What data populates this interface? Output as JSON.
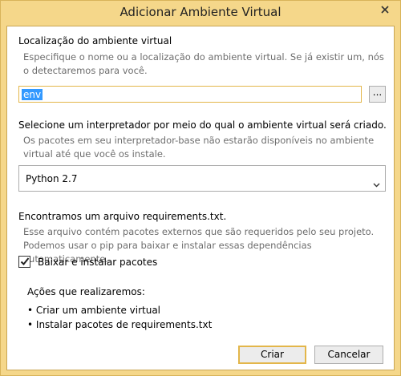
{
  "window": {
    "title": "Adicionar Ambiente Virtual"
  },
  "location": {
    "heading": "Localização do ambiente virtual",
    "description": "Especifique o nome ou a localização do ambiente virtual. Se já existir um, nós o detectaremos para você.",
    "value": "env",
    "browse_label": "..."
  },
  "interpreter": {
    "heading": "Selecione um interpretador por meio do qual o ambiente virtual será criado.",
    "description": "Os pacotes em seu interpretador-base não estarão disponíveis no ambiente virtual até que você os instale.",
    "selected": "Python 2.7"
  },
  "requirements": {
    "heading": "Encontramos um arquivo requirements.txt.",
    "description": "Esse arquivo contém pacotes externos que são requeridos pelo seu projeto. Podemos usar o pip para baixar e instalar essas dependências automaticamente.",
    "checkbox_label": "Baixar e instalar pacotes",
    "checked": true
  },
  "actions": {
    "heading": "Ações que realizaremos:",
    "items": [
      "Criar um ambiente virtual",
      "Instalar pacotes de requirements.txt"
    ]
  },
  "buttons": {
    "create": "Criar",
    "cancel": "Cancelar"
  },
  "icons": {
    "close": "close-icon",
    "dropdown": "chevron-down-icon",
    "check": "checkmark-icon"
  },
  "colors": {
    "frame": "#f5d78a",
    "focus_border": "#e3b64a",
    "selection": "#3399ff"
  }
}
